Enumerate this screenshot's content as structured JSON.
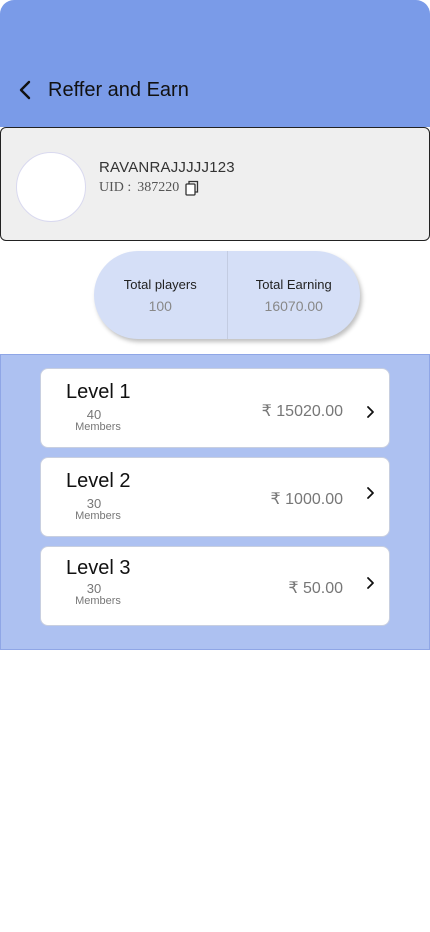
{
  "header": {
    "title": "Reffer and Earn",
    "bg_color": "#7a9be8"
  },
  "profile": {
    "username": "RAVANRAJJJJJ123",
    "uid_label": "UID :",
    "uid_value": "387220"
  },
  "stats": {
    "players_label": "Total players",
    "players_value": "100",
    "earning_label": "Total Earning",
    "earning_value": "16070.00"
  },
  "levels": [
    {
      "title": "Level 1",
      "count": "40",
      "members_label": "Members",
      "amount": "₹ 15020.00"
    },
    {
      "title": "Level 2",
      "count": "30",
      "members_label": "Members",
      "amount": "₹ 1000.00"
    },
    {
      "title": "Level 3",
      "count": "30",
      "members_label": "Members",
      "amount": "₹ 50.00"
    }
  ],
  "icons": {
    "back": "chevron-left-icon",
    "copy": "copy-icon",
    "level_chevron": "chevron-right-icon"
  }
}
